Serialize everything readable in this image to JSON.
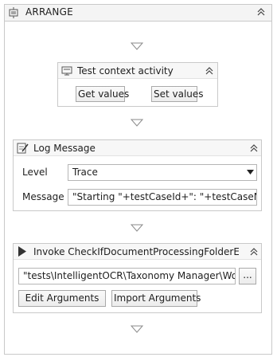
{
  "arrange": {
    "title": "ARRANGE"
  },
  "test_context": {
    "title": "Test context activity",
    "get_button": "Get values",
    "set_button": "Set values"
  },
  "log_message": {
    "title": "Log Message",
    "level_label": "Level",
    "level_value": "Trace",
    "message_label": "Message",
    "message_value": "\"Starting \"+testCaseId+\": \"+testCaseName"
  },
  "invoke": {
    "title": "Invoke CheckIfDocumentProcessingFolderExists",
    "path_value": "\"tests\\IntelligentOCR\\Taxonomy Manager\\Workfl",
    "browse_button": "...",
    "edit_arguments": "Edit Arguments",
    "import_arguments": "Import Arguments"
  },
  "colors": {
    "border": "#c9c9c9",
    "header": "#f4f4f4",
    "arrow": "#8a8a8a"
  }
}
